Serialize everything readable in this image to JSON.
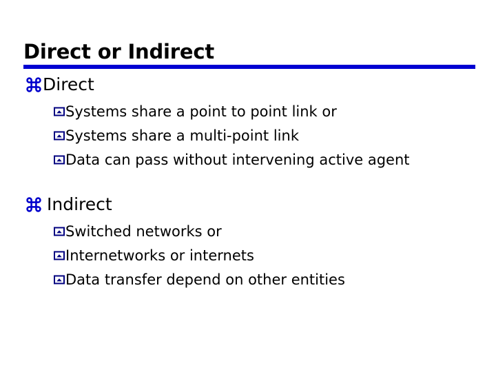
{
  "slide": {
    "title": "Direct or Indirect",
    "accent_color": "#0000d2",
    "bullet_color": "#0000cc",
    "sub_bullet_color": "#000080",
    "text_color": "#000000",
    "background_color": "#ffffff",
    "rule": {
      "name": "title-underline-rule",
      "color": "#0000d2"
    },
    "sections": [
      {
        "bullet_icon": "clover-bullet-icon",
        "heading": "Direct",
        "items": [
          {
            "bullet_icon": "square-caret-bullet-icon",
            "text": "Systems share a point to point link or"
          },
          {
            "bullet_icon": "square-caret-bullet-icon",
            "text": "Systems share a multi-point link"
          },
          {
            "bullet_icon": "square-caret-bullet-icon",
            "text": "Data can pass without intervening active agent"
          }
        ]
      },
      {
        "bullet_icon": "clover-bullet-icon",
        "heading": "Indirect",
        "items": [
          {
            "bullet_icon": "square-caret-bullet-icon",
            "text": "Switched networks or"
          },
          {
            "bullet_icon": "square-caret-bullet-icon",
            "text": "Internetworks or internets"
          },
          {
            "bullet_icon": "square-caret-bullet-icon",
            "text": "Data transfer depend on other entities"
          }
        ]
      }
    ]
  }
}
